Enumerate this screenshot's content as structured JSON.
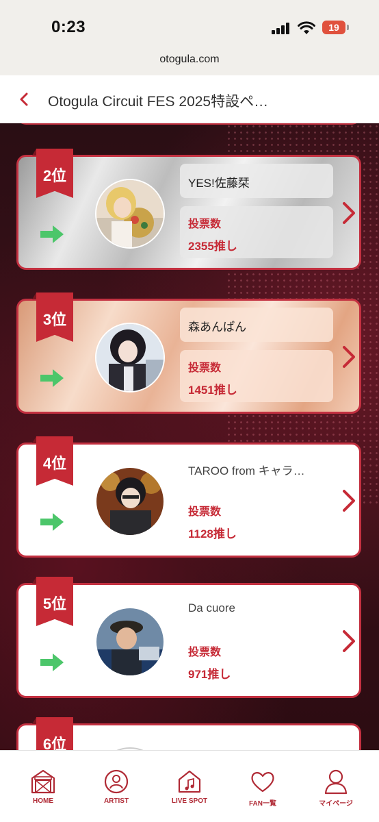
{
  "status": {
    "time": "0:23",
    "battery": "19"
  },
  "browser": {
    "url": "otogula.com"
  },
  "header": {
    "title": "Otogula Circuit FES 2025特設ペ…"
  },
  "ranking": [
    {
      "rank": "2位",
      "name": "YES!佐藤栞",
      "vote_label": "投票数",
      "votes": "2355推し",
      "style": "silver"
    },
    {
      "rank": "3位",
      "name": "森あんぱん",
      "vote_label": "投票数",
      "votes": "1451推し",
      "style": "bronze"
    },
    {
      "rank": "4位",
      "name": "TAROO from キャラ…",
      "vote_label": "投票数",
      "votes": "1128推し",
      "style": "plain"
    },
    {
      "rank": "5位",
      "name": "Da cuore",
      "vote_label": "投票数",
      "votes": "971推し",
      "style": "plain"
    },
    {
      "rank": "6位",
      "name": "",
      "vote_label": "",
      "votes": "",
      "style": "plain"
    }
  ],
  "bottom_nav": [
    {
      "label": "HOME",
      "icon": "home-icon"
    },
    {
      "label": "ARTIST",
      "icon": "artist-icon"
    },
    {
      "label": "LIVE SPOT",
      "icon": "live-spot-icon"
    },
    {
      "label": "FAN一覧",
      "icon": "heart-icon"
    },
    {
      "label": "マイページ",
      "icon": "user-icon"
    }
  ],
  "colors": {
    "accent": "#c62a36",
    "trend": "#4cc66a"
  }
}
